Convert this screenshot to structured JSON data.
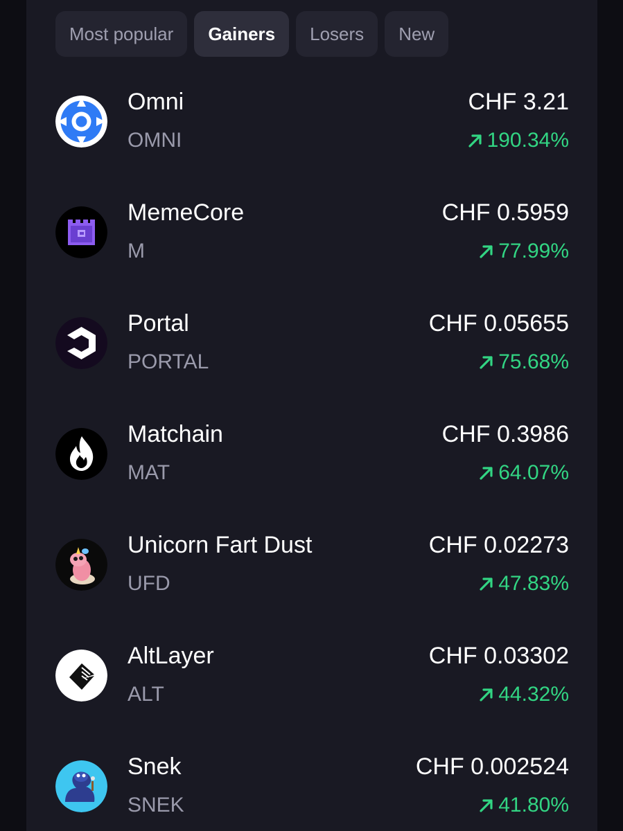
{
  "tabs": [
    {
      "label": "Most popular",
      "active": false
    },
    {
      "label": "Gainers",
      "active": true
    },
    {
      "label": "Losers",
      "active": false
    },
    {
      "label": "New",
      "active": false
    }
  ],
  "colors": {
    "positive": "#32d583",
    "background": "#191923",
    "tab_bg": "#242430",
    "tab_active_bg": "#2e2e3b"
  },
  "coins": [
    {
      "name": "Omni",
      "symbol": "OMNI",
      "price": "CHF 3.21",
      "change": "190.34%",
      "icon": "omni-logo-icon"
    },
    {
      "name": "MemeCore",
      "symbol": "M",
      "price": "CHF 0.5959",
      "change": "77.99%",
      "icon": "memecore-logo-icon"
    },
    {
      "name": "Portal",
      "symbol": "PORTAL",
      "price": "CHF 0.05655",
      "change": "75.68%",
      "icon": "portal-logo-icon"
    },
    {
      "name": "Matchain",
      "symbol": "MAT",
      "price": "CHF 0.3986",
      "change": "64.07%",
      "icon": "matchain-logo-icon"
    },
    {
      "name": "Unicorn Fart Dust",
      "symbol": "UFD",
      "price": "CHF 0.02273",
      "change": "47.83%",
      "icon": "unicorn-fart-dust-logo-icon"
    },
    {
      "name": "AltLayer",
      "symbol": "ALT",
      "price": "CHF 0.03302",
      "change": "44.32%",
      "icon": "altlayer-logo-icon"
    },
    {
      "name": "Snek",
      "symbol": "SNEK",
      "price": "CHF 0.002524",
      "change": "41.80%",
      "icon": "snek-logo-icon"
    }
  ]
}
